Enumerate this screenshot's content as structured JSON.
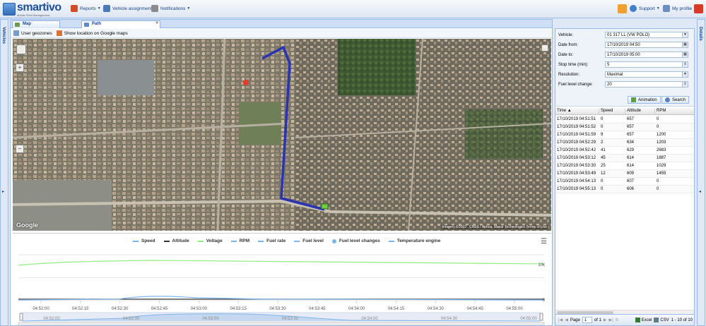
{
  "app": {
    "name": "smartivo",
    "tagline": "Mobile Fleet Management"
  },
  "topnav": {
    "reports": "Reports",
    "vehicle_assignment": "Vehicle assignment",
    "notifications": "Notifications",
    "support": "Support",
    "profile": "My profile"
  },
  "sidebars": {
    "left": "Vehicles",
    "right": "Details"
  },
  "tabs": [
    {
      "label": "Map"
    },
    {
      "label": "Path"
    }
  ],
  "toolbar": {
    "geozones": "User geozones",
    "google_maps": "Show location on Google maps"
  },
  "map": {
    "attribution": "Imagery ©2019 , CNES / Airbus, Maxar Technologies   Terms of Use",
    "google": "Google",
    "zoom_in": "+",
    "zoom_out": "−"
  },
  "legend": [
    {
      "name": "Speed",
      "color": "#7cb5ec",
      "kind": "line"
    },
    {
      "name": "Altitude",
      "color": "#333333",
      "kind": "line"
    },
    {
      "name": "Voltage",
      "color": "#90ed7d",
      "kind": "line"
    },
    {
      "name": "RPM",
      "color": "#7cb5ec",
      "kind": "line"
    },
    {
      "name": "Fuel rate",
      "color": "#7cb5ec",
      "kind": "line"
    },
    {
      "name": "Fuel level",
      "color": "#7cb5ec",
      "kind": "line"
    },
    {
      "name": "Fuel level changes",
      "color": "#7cb5ec",
      "kind": "dot"
    },
    {
      "name": "Temperature engine",
      "color": "#7cb5ec",
      "kind": "line"
    }
  ],
  "chart_data": {
    "type": "line",
    "x_ticks": [
      "04:52:00",
      "04:52:15",
      "04:52:30",
      "04:52:45",
      "04:53:00",
      "04:53:15",
      "04:53:30",
      "04:53:45",
      "04:54:00",
      "04:54:15",
      "04:54:30",
      "04:54:45",
      "04:55:00"
    ],
    "y_right_ticks": [
      "10k",
      "0"
    ],
    "navigator_ticks": [
      "04:52:00",
      "04:52:30",
      "04:53:00",
      "04:53:30",
      "04:54:00",
      "04:54:30",
      "04:55:00"
    ],
    "time_range": [
      "04:51:51",
      "04:55:13"
    ]
  },
  "form": {
    "vehicle_label": "Vehicle:",
    "vehicle_value": "01 317 LL (VW POLO)",
    "date_from_label": "Date from:",
    "date_from_value": "17/10/2019 04:50",
    "date_to_label": "Date to:",
    "date_to_value": "17/10/2019 05:00",
    "stop_time_label": "Stop time (min):",
    "stop_time_value": "5",
    "resolution_label": "Resolution:",
    "resolution_value": "Maximal",
    "fuel_label": "Fuel level change:",
    "fuel_value": "20",
    "animation_btn": "Animation",
    "search_btn": "Search"
  },
  "grid": {
    "columns": [
      "Time",
      "Speed",
      "Altitude",
      "RPM"
    ],
    "rows": [
      [
        "17/10/2019 04:51:51",
        "0",
        "657",
        "0"
      ],
      [
        "17/10/2019 04:51:52",
        "0",
        "657",
        "0"
      ],
      [
        "17/10/2019 04:51:59",
        "9",
        "657",
        "1200"
      ],
      [
        "17/10/2019 04:52:29",
        "2",
        "634",
        "1203"
      ],
      [
        "17/10/2019 04:52:42",
        "41",
        "629",
        "2683"
      ],
      [
        "17/10/2019 04:53:12",
        "45",
        "614",
        "1887"
      ],
      [
        "17/10/2019 04:53:30",
        "25",
        "614",
        "1029"
      ],
      [
        "17/10/2019 04:53:49",
        "12",
        "609",
        "1455"
      ],
      [
        "17/10/2019 04:54:13",
        "0",
        "607",
        "0"
      ],
      [
        "17/10/2019 04:55:13",
        "0",
        "606",
        "0"
      ]
    ]
  },
  "pager": {
    "page_label": "Page",
    "page_value": "1",
    "of_label": "of 1",
    "excel": "Excel",
    "csv": "CSV",
    "range": "1 - 10 of 10"
  }
}
